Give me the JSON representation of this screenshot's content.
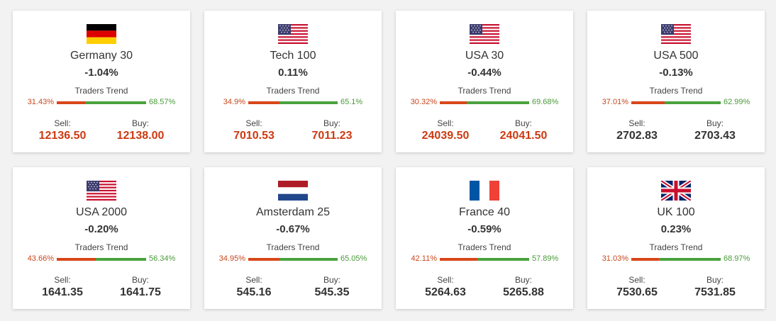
{
  "labels": {
    "trend": "Traders Trend",
    "sell": "Sell:",
    "buy": "Buy:"
  },
  "colors": {
    "sell": "#d8471a",
    "buy": "#4aa23e",
    "price_up_down": "#cc3a12",
    "price_neutral": "#333333"
  },
  "cards": [
    {
      "flag": "germany-flag-icon",
      "name": "Germany 30",
      "change": "-1.04%",
      "sell_pct": "31.43%",
      "buy_pct": "68.57%",
      "sell_share": 0.3143,
      "sell": "12136.50",
      "buy": "12138.00",
      "price_color": "red"
    },
    {
      "flag": "usa-flag-icon",
      "name": "Tech 100",
      "change": "0.11%",
      "sell_pct": "34.9%",
      "buy_pct": "65.1%",
      "sell_share": 0.349,
      "sell": "7010.53",
      "buy": "7011.23",
      "price_color": "red"
    },
    {
      "flag": "usa-flag-icon",
      "name": "USA 30",
      "change": "-0.44%",
      "sell_pct": "30.32%",
      "buy_pct": "69.68%",
      "sell_share": 0.3032,
      "sell": "24039.50",
      "buy": "24041.50",
      "price_color": "red"
    },
    {
      "flag": "usa-flag-icon",
      "name": "USA 500",
      "change": "-0.13%",
      "sell_pct": "37.01%",
      "buy_pct": "62.99%",
      "sell_share": 0.3701,
      "sell": "2702.83",
      "buy": "2703.43",
      "price_color": "dark"
    },
    {
      "flag": "usa-flag-icon",
      "name": "USA 2000",
      "change": "-0.20%",
      "sell_pct": "43.66%",
      "buy_pct": "56.34%",
      "sell_share": 0.4366,
      "sell": "1641.35",
      "buy": "1641.75",
      "price_color": "dark"
    },
    {
      "flag": "netherlands-flag-icon",
      "name": "Amsterdam 25",
      "change": "-0.67%",
      "sell_pct": "34.95%",
      "buy_pct": "65.05%",
      "sell_share": 0.3495,
      "sell": "545.16",
      "buy": "545.35",
      "price_color": "dark"
    },
    {
      "flag": "france-flag-icon",
      "name": "France 40",
      "change": "-0.59%",
      "sell_pct": "42.11%",
      "buy_pct": "57.89%",
      "sell_share": 0.4211,
      "sell": "5264.63",
      "buy": "5265.88",
      "price_color": "dark"
    },
    {
      "flag": "uk-flag-icon",
      "name": "UK 100",
      "change": "0.23%",
      "sell_pct": "31.03%",
      "buy_pct": "68.97%",
      "sell_share": 0.3103,
      "sell": "7530.65",
      "buy": "7531.85",
      "price_color": "dark"
    }
  ]
}
